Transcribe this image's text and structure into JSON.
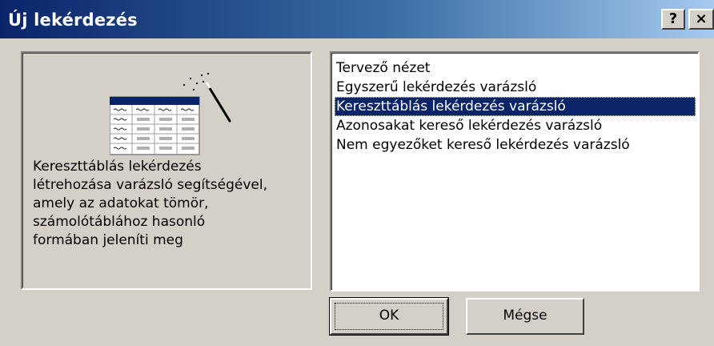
{
  "window": {
    "title": "Új lekérdezés",
    "help_button": "?",
    "close_button": "×"
  },
  "info": {
    "description": "Kereszttáblás lekérdezés\nlétrehozása varázsló segítségével,\namely az adatokat tömör,\nszámolótáblához hasonló\nformában jeleníti meg"
  },
  "query_types": {
    "items": [
      {
        "label": "Tervező nézet",
        "selected": false
      },
      {
        "label": "Egyszerű lekérdezés varázsló",
        "selected": false
      },
      {
        "label": "Kereszttáblás lekérdezés varázsló",
        "selected": true
      },
      {
        "label": "Azonosakat kereső lekérdezés varázsló",
        "selected": false
      },
      {
        "label": "Nem egyezőket kereső lekérdezés varázsló",
        "selected": false
      }
    ]
  },
  "buttons": {
    "ok": "OK",
    "cancel": "Mégse"
  },
  "colors": {
    "selection": "#0a246a",
    "dialog_face": "#d4d0c8"
  }
}
